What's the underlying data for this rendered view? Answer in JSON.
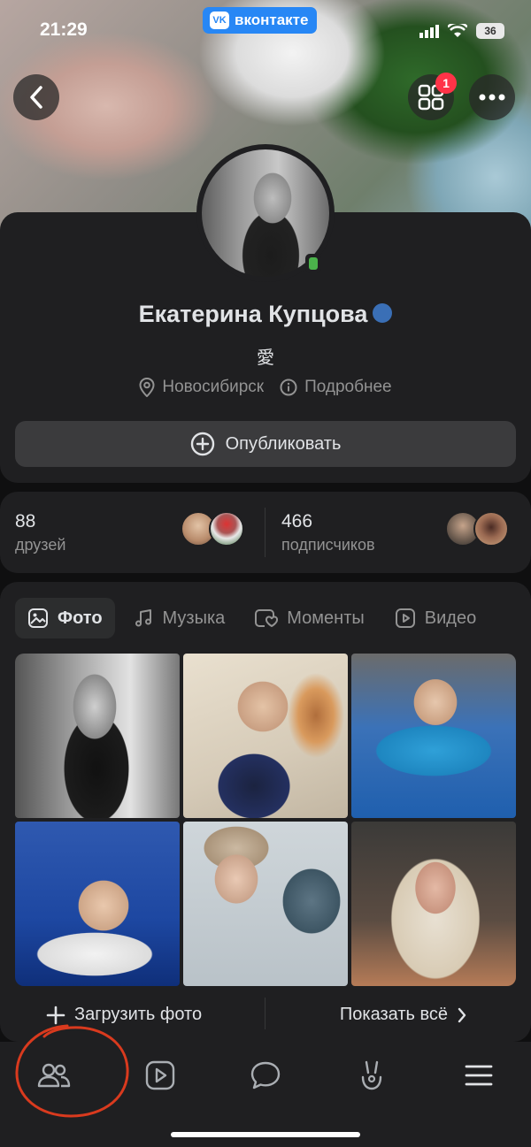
{
  "status_bar": {
    "time": "21:29",
    "app_badge": "вконтакте",
    "battery": "36"
  },
  "profile": {
    "name": "Екатерина Купцова",
    "status": "愛",
    "city": "Новосибирск",
    "details_link": "Подробнее",
    "publish_button": "Опубликовать"
  },
  "counts": {
    "friends": {
      "number": "88",
      "label": "друзей"
    },
    "followers": {
      "number": "466",
      "label": "подписчиков"
    }
  },
  "media": {
    "tabs": [
      {
        "label": "Фото",
        "icon": "photo-icon",
        "active": true
      },
      {
        "label": "Музыка",
        "icon": "music-icon",
        "active": false
      },
      {
        "label": "Моменты",
        "icon": "moments-icon",
        "active": false
      },
      {
        "label": "Видео",
        "icon": "video-icon",
        "active": false
      }
    ],
    "upload_label": "Загрузить фото",
    "show_all_label": "Показать всё"
  },
  "bottom_nav": {
    "items": [
      "friends-icon",
      "video-icon",
      "messages-icon",
      "clips-icon",
      "menu-icon"
    ]
  },
  "colors": {
    "accent": "#2787f5",
    "notification": "#ff3347",
    "online": "#4bb34b",
    "annotation": "#d93a1e"
  },
  "notification_count": "1"
}
